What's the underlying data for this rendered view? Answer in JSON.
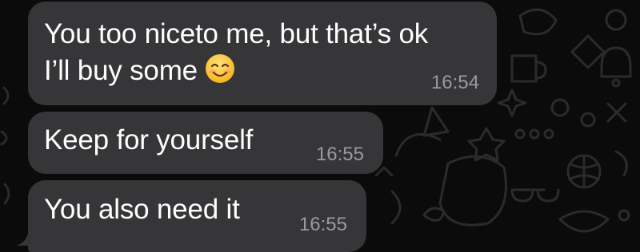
{
  "conversation": {
    "messages": [
      {
        "lines": [
          "You too niceto me, but that’s ok",
          "I’ll buy some"
        ],
        "emoji": "smiling-face-icon",
        "time": "16:54"
      },
      {
        "lines": [
          "Keep for yourself"
        ],
        "time": "16:55"
      },
      {
        "lines": [
          "You also need it"
        ],
        "time": "16:55"
      }
    ]
  },
  "colors": {
    "background": "#0b0b0b",
    "bubble": "#363638",
    "text": "#ffffff",
    "timestamp": "#9a9a9e",
    "emoji_face": "#ffcc3a"
  }
}
